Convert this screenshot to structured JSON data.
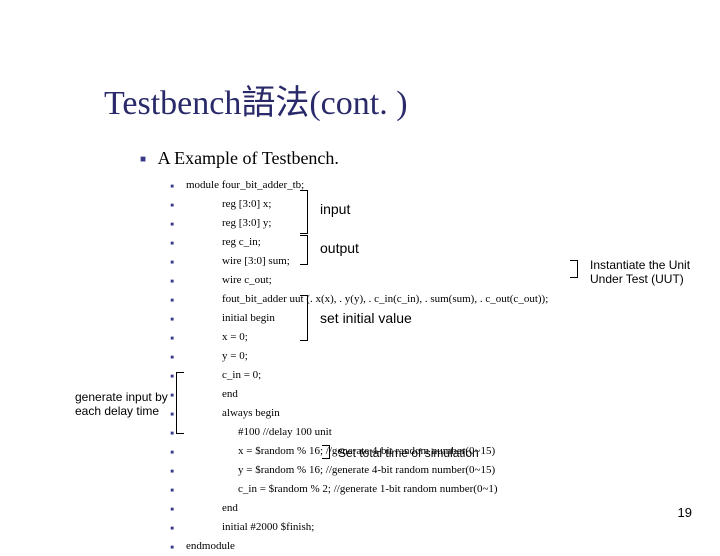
{
  "title": "Testbench語法(cont. )",
  "subtitle": "A Example of Testbench.",
  "code": [
    {
      "i": 0,
      "t": "module four_bit_adder_tb;"
    },
    {
      "i": 1,
      "t": "reg [3:0] x;"
    },
    {
      "i": 1,
      "t": "reg [3:0] y;"
    },
    {
      "i": 1,
      "t": "reg c_in;"
    },
    {
      "i": 1,
      "t": "wire [3:0] sum;"
    },
    {
      "i": 1,
      "t": "wire c_out;"
    },
    {
      "i": 1,
      "t": "fout_bit_adder uut (. x(x), . y(y), . c_in(c_in), . sum(sum), . c_out(c_out));"
    },
    {
      "i": 1,
      "t": "initial begin"
    },
    {
      "i": 1,
      "t": "x = 0;"
    },
    {
      "i": 1,
      "t": "y = 0;"
    },
    {
      "i": 1,
      "t": "c_in = 0;"
    },
    {
      "i": 1,
      "t": "end"
    },
    {
      "i": 1,
      "t": "always begin"
    },
    {
      "i": 2,
      "t": "#100                            //delay 100 unit"
    },
    {
      "i": 2,
      "t": "x = $random % 16;   //generate 4-bit random number(0~15)"
    },
    {
      "i": 2,
      "t": "y = $random % 16;   //generate 4-bit random number(0~15)"
    },
    {
      "i": 2,
      "t": "c_in = $random % 2;  //generate 1-bit random number(0~1)"
    },
    {
      "i": 1,
      "t": "end"
    },
    {
      "i": 1,
      "t": "initial #2000 $finish;"
    },
    {
      "i": 0,
      "t": "endmodule"
    }
  ],
  "annotations": {
    "input": "input",
    "output": "output",
    "set_initial": "set initial value",
    "generate_1": "generate input by",
    "generate_2": "each delay time",
    "set_total": "Set total time of simulation",
    "uut_1": "Instantiate the Unit",
    "uut_2": "Under Test (UUT)"
  },
  "slide_number": "19"
}
